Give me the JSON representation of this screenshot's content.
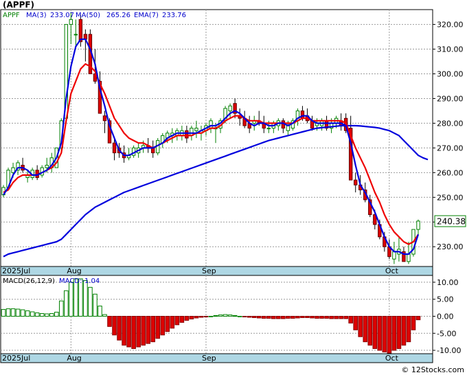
{
  "title": "(APPF)",
  "price_legend": [
    {
      "label": "APPF",
      "color": "#008000"
    },
    {
      "label": "MA(3)",
      "color": "#0000cc"
    },
    {
      "label": "233.07",
      "color": "#0000cc"
    },
    {
      "label": "MA(50)",
      "color": "#0000cc"
    },
    {
      "label": "265.26",
      "color": "#0000cc"
    },
    {
      "label": "EMA(7)",
      "color": "#0000cc"
    },
    {
      "label": "233.76",
      "color": "#0000cc"
    }
  ],
  "macd_legend": [
    {
      "label": "MACD(26,12,9)",
      "color": "#000000"
    },
    {
      "label": "MACD:-1.04",
      "color": "#0000cc"
    }
  ],
  "last_price": "240.38",
  "watermark": "© 12Stocks.com",
  "chart_data": [
    {
      "type": "candlestick",
      "panel": "price",
      "ylim": [
        222,
        326
      ],
      "y_ticks": [
        230,
        240,
        250,
        260,
        270,
        280,
        290,
        300,
        310,
        320
      ],
      "y_tick_labels": [
        "230.00",
        "240.00",
        "250.00",
        "260.00",
        "270.00",
        "280.00",
        "290.00",
        "300.00",
        "310.00",
        "320.00"
      ],
      "x_labels": [
        "2025Jul",
        "Aug",
        "Sep",
        "Oct"
      ],
      "x_label_index": [
        0,
        14,
        42,
        80
      ],
      "grid": true,
      "colors": {
        "up": "#008000",
        "down": "#dd0000",
        "ma_short": "#0000dd",
        "ma_long": "#0000dd",
        "ema": "#ee0000"
      },
      "candles": [
        [
          251,
          255,
          250,
          254
        ],
        [
          254,
          262,
          253,
          261
        ],
        [
          260,
          264,
          258,
          262
        ],
        [
          261,
          265,
          259,
          264
        ],
        [
          263,
          266,
          260,
          261
        ],
        [
          258,
          261,
          256,
          259
        ],
        [
          258,
          262,
          257,
          261
        ],
        [
          261,
          263,
          257,
          258
        ],
        [
          259,
          263,
          258,
          262
        ],
        [
          262,
          266,
          260,
          263
        ],
        [
          262,
          268,
          260,
          266
        ],
        [
          262,
          270,
          262,
          270
        ],
        [
          270,
          282,
          268,
          281
        ],
        [
          282,
          320,
          282,
          320
        ],
        [
          320,
          325,
          312,
          322
        ],
        [
          316,
          322,
          310,
          316
        ],
        [
          322,
          324,
          311,
          313
        ],
        [
          316,
          318,
          305,
          314
        ],
        [
          316,
          318,
          300,
          300
        ],
        [
          300,
          310,
          296,
          297
        ],
        [
          297,
          301,
          284,
          284
        ],
        [
          283,
          285,
          276,
          281
        ],
        [
          281,
          282,
          272,
          272
        ],
        [
          272,
          274,
          265,
          268
        ],
        [
          270,
          272,
          266,
          268
        ],
        [
          268,
          271,
          264,
          266
        ],
        [
          266,
          270,
          265,
          267
        ],
        [
          267,
          271,
          266,
          270
        ],
        [
          268,
          272,
          266,
          270
        ],
        [
          270,
          273,
          268,
          271
        ],
        [
          271,
          274,
          268,
          270
        ],
        [
          270,
          273,
          266,
          268
        ],
        [
          268,
          274,
          267,
          273
        ],
        [
          272,
          276,
          270,
          275
        ],
        [
          274,
          277,
          272,
          276
        ],
        [
          275,
          278,
          272,
          276
        ],
        [
          275,
          278,
          273,
          277
        ],
        [
          275,
          279,
          273,
          277
        ],
        [
          277,
          279,
          272,
          274
        ],
        [
          275,
          279,
          273,
          278
        ],
        [
          277,
          281,
          274,
          278
        ],
        [
          276,
          279,
          273,
          277
        ],
        [
          277,
          280,
          275,
          279
        ],
        [
          278,
          282,
          276,
          281
        ],
        [
          278,
          280,
          272,
          278
        ],
        [
          278,
          282,
          276,
          281
        ],
        [
          281,
          287,
          280,
          286
        ],
        [
          285,
          288,
          282,
          287
        ],
        [
          288,
          290,
          282,
          284
        ],
        [
          283,
          286,
          279,
          282
        ],
        [
          282,
          285,
          278,
          279
        ],
        [
          280,
          283,
          276,
          278
        ],
        [
          280,
          283,
          277,
          281
        ],
        [
          281,
          285,
          279,
          280
        ],
        [
          280,
          283,
          276,
          278
        ],
        [
          278,
          281,
          276,
          278
        ],
        [
          278,
          281,
          276,
          280
        ],
        [
          279,
          282,
          277,
          281
        ],
        [
          281,
          282,
          276,
          278
        ],
        [
          277,
          281,
          275,
          279
        ],
        [
          278,
          282,
          277,
          281
        ],
        [
          281,
          286,
          279,
          285
        ],
        [
          285,
          287,
          281,
          282
        ],
        [
          283,
          286,
          280,
          281
        ],
        [
          281,
          283,
          277,
          278
        ],
        [
          279,
          282,
          277,
          280
        ],
        [
          279,
          282,
          277,
          281
        ],
        [
          281,
          283,
          277,
          278
        ],
        [
          278,
          282,
          276,
          280
        ],
        [
          280,
          283,
          278,
          282
        ],
        [
          281,
          284,
          277,
          279
        ],
        [
          282,
          284,
          276,
          277
        ],
        [
          278,
          283,
          271,
          257
        ],
        [
          257,
          260,
          252,
          255
        ],
        [
          255,
          259,
          251,
          253
        ],
        [
          253,
          256,
          248,
          249
        ],
        [
          249,
          251,
          242,
          243
        ],
        [
          243,
          245,
          237,
          239
        ],
        [
          239,
          241,
          233,
          234
        ],
        [
          234,
          236,
          228,
          230
        ],
        [
          230,
          233,
          225,
          226
        ],
        [
          225,
          232,
          223,
          228
        ],
        [
          227,
          234,
          224,
          229
        ],
        [
          228,
          230,
          224,
          224
        ],
        [
          224,
          232,
          223,
          227
        ],
        [
          227,
          237,
          226,
          237
        ],
        [
          237,
          241,
          235,
          240.38
        ]
      ],
      "ma_short": [
        251,
        254,
        259,
        262,
        262,
        261,
        259,
        259,
        260,
        261,
        263,
        266,
        272,
        290,
        303,
        311,
        314,
        314,
        310,
        304,
        294,
        287,
        279,
        274,
        269,
        267,
        267,
        268,
        269,
        270,
        270,
        270,
        271,
        272,
        274,
        275,
        276,
        276,
        276,
        276,
        276,
        277,
        278,
        279,
        279,
        280,
        282,
        284,
        285,
        284,
        282,
        280,
        279,
        280,
        280,
        279,
        279,
        280,
        280,
        279,
        280,
        282,
        283,
        283,
        281,
        280,
        280,
        280,
        280,
        280,
        280,
        279,
        272,
        263,
        255,
        252,
        248,
        244,
        239,
        234,
        230,
        228,
        228,
        227,
        227,
        229,
        235
      ],
      "ema": [
        252,
        253,
        256,
        258,
        259,
        259,
        259,
        259,
        260,
        261,
        262,
        264,
        268,
        281,
        292,
        297,
        302,
        304,
        303,
        301,
        296,
        292,
        287,
        282,
        279,
        276,
        274,
        273,
        272,
        272,
        271,
        270,
        271,
        272,
        273,
        274,
        275,
        275,
        275,
        275,
        276,
        276,
        277,
        278,
        278,
        279,
        281,
        282,
        283,
        283,
        282,
        281,
        281,
        281,
        280,
        280,
        280,
        280,
        280,
        280,
        280,
        281,
        282,
        282,
        281,
        281,
        281,
        281,
        281,
        281,
        281,
        280,
        275,
        270,
        266,
        262,
        257,
        252,
        248,
        243,
        239,
        236,
        234,
        232,
        231,
        232,
        235
      ],
      "ma_long": [
        226,
        227,
        227.5,
        228,
        228.5,
        229,
        229.5,
        230,
        230.5,
        231,
        231.5,
        232,
        233,
        235,
        237,
        239,
        241,
        243,
        244.5,
        246,
        247,
        248,
        249,
        250,
        251,
        252,
        252.7,
        253.4,
        254.1,
        254.8,
        255.5,
        256.2,
        256.9,
        257.6,
        258.3,
        259,
        259.7,
        260.4,
        261.1,
        261.8,
        262.5,
        263.2,
        263.9,
        264.6,
        265.3,
        266,
        266.7,
        267.4,
        268.1,
        268.8,
        269.5,
        270.2,
        270.9,
        271.6,
        272.3,
        273,
        273.5,
        274,
        274.5,
        275,
        275.5,
        276,
        276.5,
        277,
        277.5,
        278,
        278.2,
        278.4,
        278.6,
        278.8,
        279,
        279,
        279,
        279,
        278.9,
        278.7,
        278.5,
        278.3,
        278,
        277.5,
        277,
        276,
        275,
        273,
        271,
        269,
        267,
        266,
        265.26
      ]
    },
    {
      "type": "bar",
      "panel": "macd",
      "title": "MACD(26,12,9)",
      "ylim": [
        -11,
        12
      ],
      "y_ticks": [
        10,
        5,
        0,
        -5,
        -10
      ],
      "y_tick_labels": [
        "10.00",
        "5.00",
        "0.00",
        "-5.00",
        "-10.00"
      ],
      "x_labels": [
        "2025Jul",
        "Aug",
        "Sep",
        "Oct"
      ],
      "x_label_index": [
        0,
        14,
        42,
        80
      ],
      "grid": true,
      "colors": {
        "positive": "#008000",
        "negative": "#dd0000"
      },
      "values": [
        2.0,
        2.2,
        2.2,
        2.1,
        1.9,
        1.6,
        1.3,
        1.0,
        0.8,
        0.7,
        0.8,
        1.2,
        4.5,
        7.5,
        10.0,
        11.0,
        11.0,
        10.5,
        8.5,
        6.5,
        3.0,
        0.5,
        -3.0,
        -5.5,
        -7.0,
        -8.5,
        -9.0,
        -9.5,
        -9.0,
        -8.5,
        -8.0,
        -7.5,
        -6.5,
        -5.5,
        -4.5,
        -3.5,
        -2.5,
        -1.8,
        -1.2,
        -0.8,
        -0.5,
        -0.3,
        -0.2,
        0.0,
        0.2,
        0.4,
        0.5,
        0.4,
        0.2,
        0.0,
        -0.2,
        -0.3,
        -0.4,
        -0.5,
        -0.6,
        -0.6,
        -0.7,
        -0.7,
        -0.7,
        -0.6,
        -0.6,
        -0.5,
        -0.4,
        -0.4,
        -0.5,
        -0.6,
        -0.6,
        -0.6,
        -0.7,
        -0.7,
        -0.7,
        -0.7,
        -2.0,
        -4.0,
        -6.0,
        -7.5,
        -8.5,
        -9.5,
        -10.0,
        -10.5,
        -10.8,
        -10.0,
        -9.5,
        -8.5,
        -7.5,
        -4.0,
        -1.04
      ]
    }
  ]
}
